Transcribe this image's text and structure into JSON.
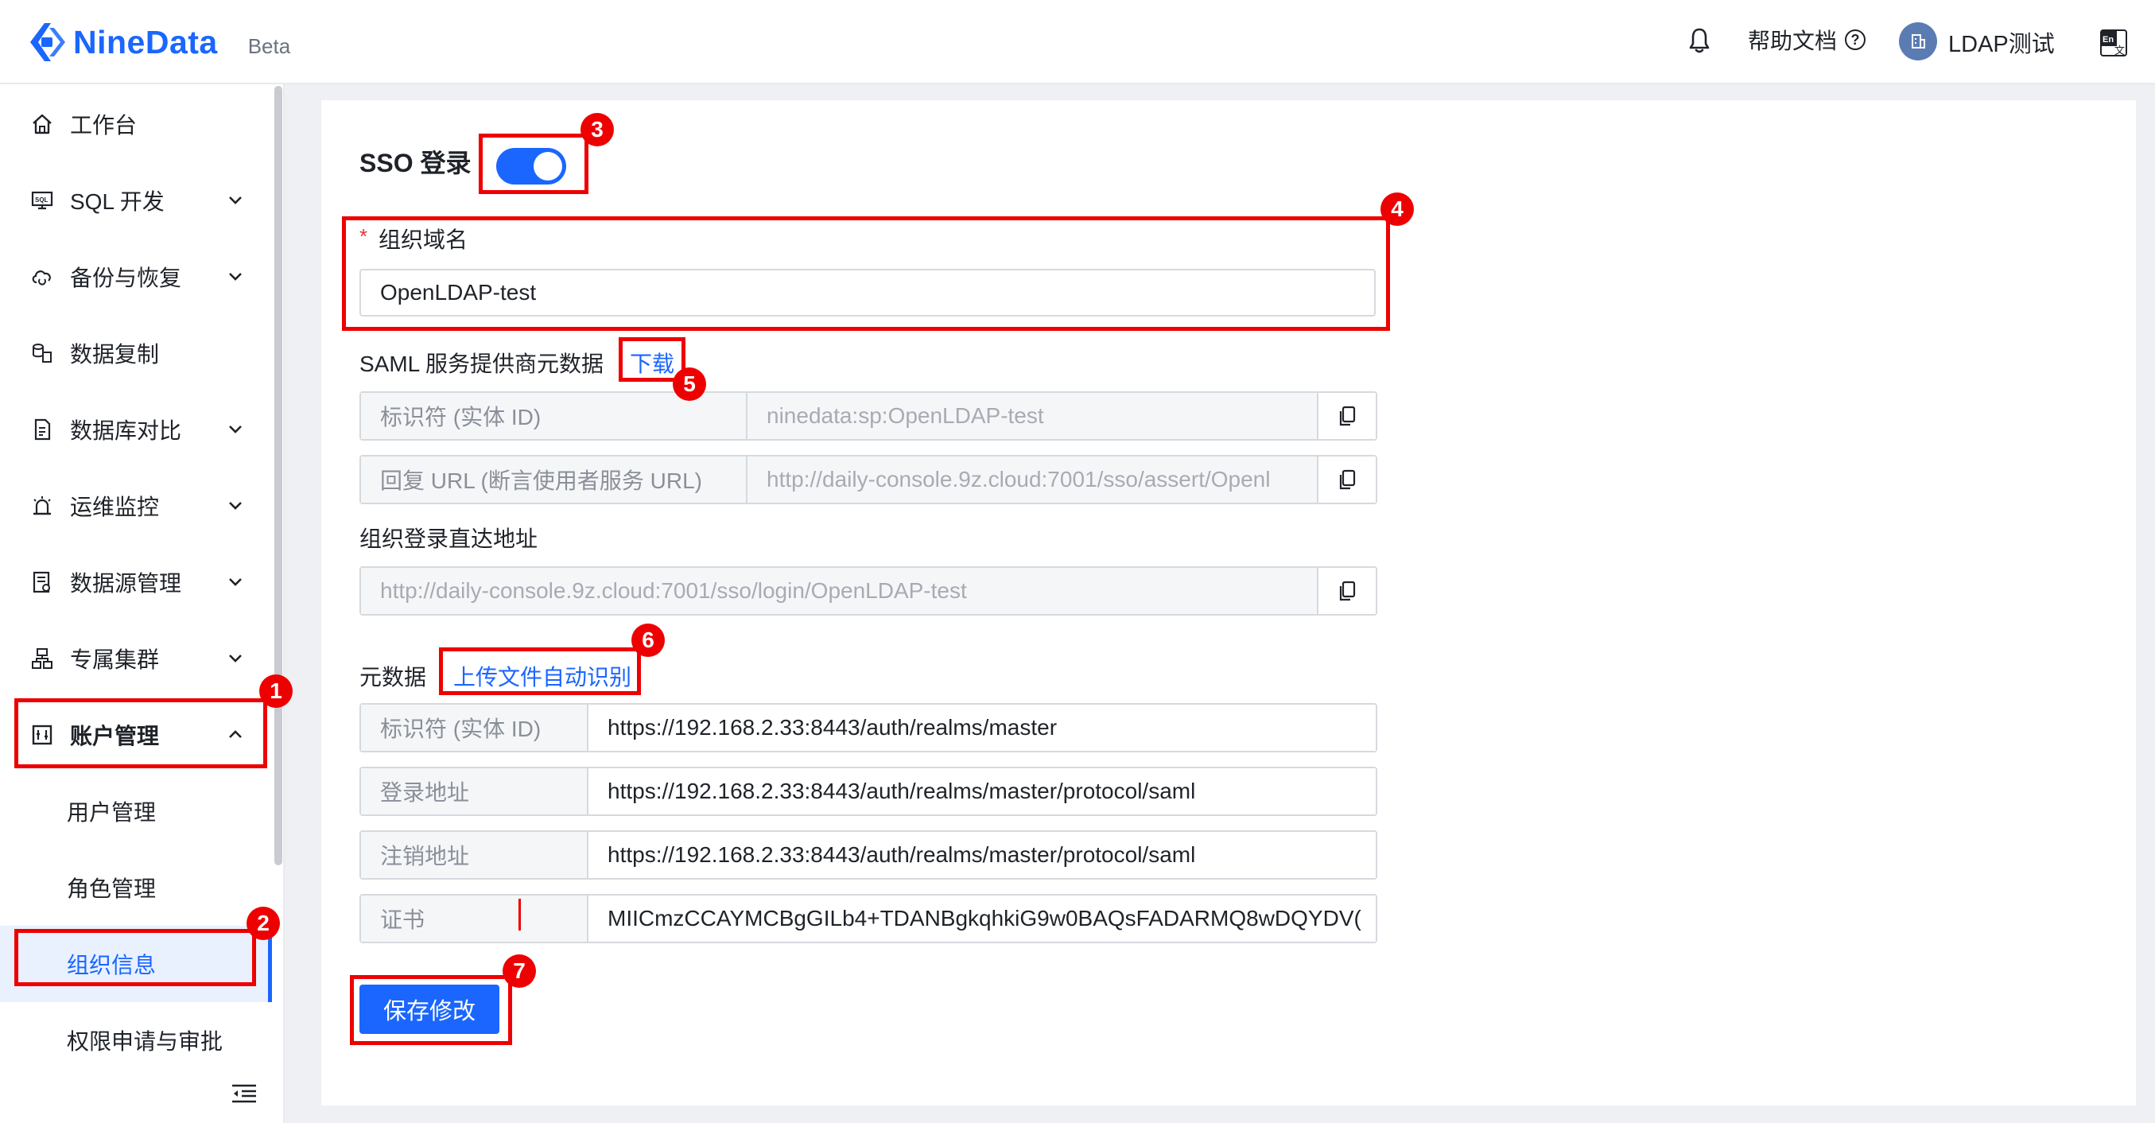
{
  "header": {
    "brand": "NineData",
    "beta": "Beta",
    "help": "帮助文档",
    "help_q": "?",
    "user": "LDAP测试",
    "brand_color": "#1a66ff"
  },
  "sidebar": {
    "items": [
      {
        "label": "工作台",
        "icon": "home-icon"
      },
      {
        "label": "SQL 开发",
        "icon": "sql-icon"
      },
      {
        "label": "备份与恢复",
        "icon": "cloud-sync-icon"
      },
      {
        "label": "数据复制",
        "icon": "copy-db-icon"
      },
      {
        "label": "数据库对比",
        "icon": "compare-doc-icon"
      },
      {
        "label": "运维监控",
        "icon": "alarm-icon"
      },
      {
        "label": "数据源管理",
        "icon": "datasource-icon"
      },
      {
        "label": "专属集群",
        "icon": "cluster-icon"
      },
      {
        "label": "账户管理",
        "icon": "account-icon"
      },
      {
        "label": "用户管理"
      },
      {
        "label": "角色管理"
      },
      {
        "label": "组织信息"
      },
      {
        "label": "权限申请与审批"
      }
    ],
    "active": "组织信息"
  },
  "form": {
    "sso_label": "SSO 登录",
    "sso_enabled": true,
    "required_mark": "*",
    "domain_label": "组织域名",
    "domain_value": "OpenLDAP-test",
    "saml_label": "SAML 服务提供商元数据",
    "download_link": "下载",
    "sp_rows": [
      {
        "key": "标识符 (实体 ID)",
        "value": "ninedata:sp:OpenLDAP-test"
      },
      {
        "key": "回复 URL (断言使用者服务 URL)",
        "value": "http://daily-console.9z.cloud:7001/sso/assert/Openl"
      }
    ],
    "direct_label": "组织登录直达地址",
    "direct_value": "http://daily-console.9z.cloud:7001/sso/login/OpenLDAP-test",
    "metadata_label": "元数据",
    "upload_link": "上传文件自动识别",
    "meta_rows": [
      {
        "key": "标识符 (实体 ID)",
        "value": "https://192.168.2.33:8443/auth/realms/master"
      },
      {
        "key": "登录地址",
        "value": "https://192.168.2.33:8443/auth/realms/master/protocol/saml"
      },
      {
        "key": "注销地址",
        "value": "https://192.168.2.33:8443/auth/realms/master/protocol/saml"
      },
      {
        "key": "证书",
        "value": "MIICmzCCAYMCBgGILb4+TDANBgkqhkiG9w0BAQsFADARMQ8wDQYDV("
      }
    ],
    "save_label": "保存修改"
  },
  "annotations": [
    "1",
    "2",
    "3",
    "4",
    "5",
    "6",
    "7"
  ],
  "annotation_color": "#e00000"
}
